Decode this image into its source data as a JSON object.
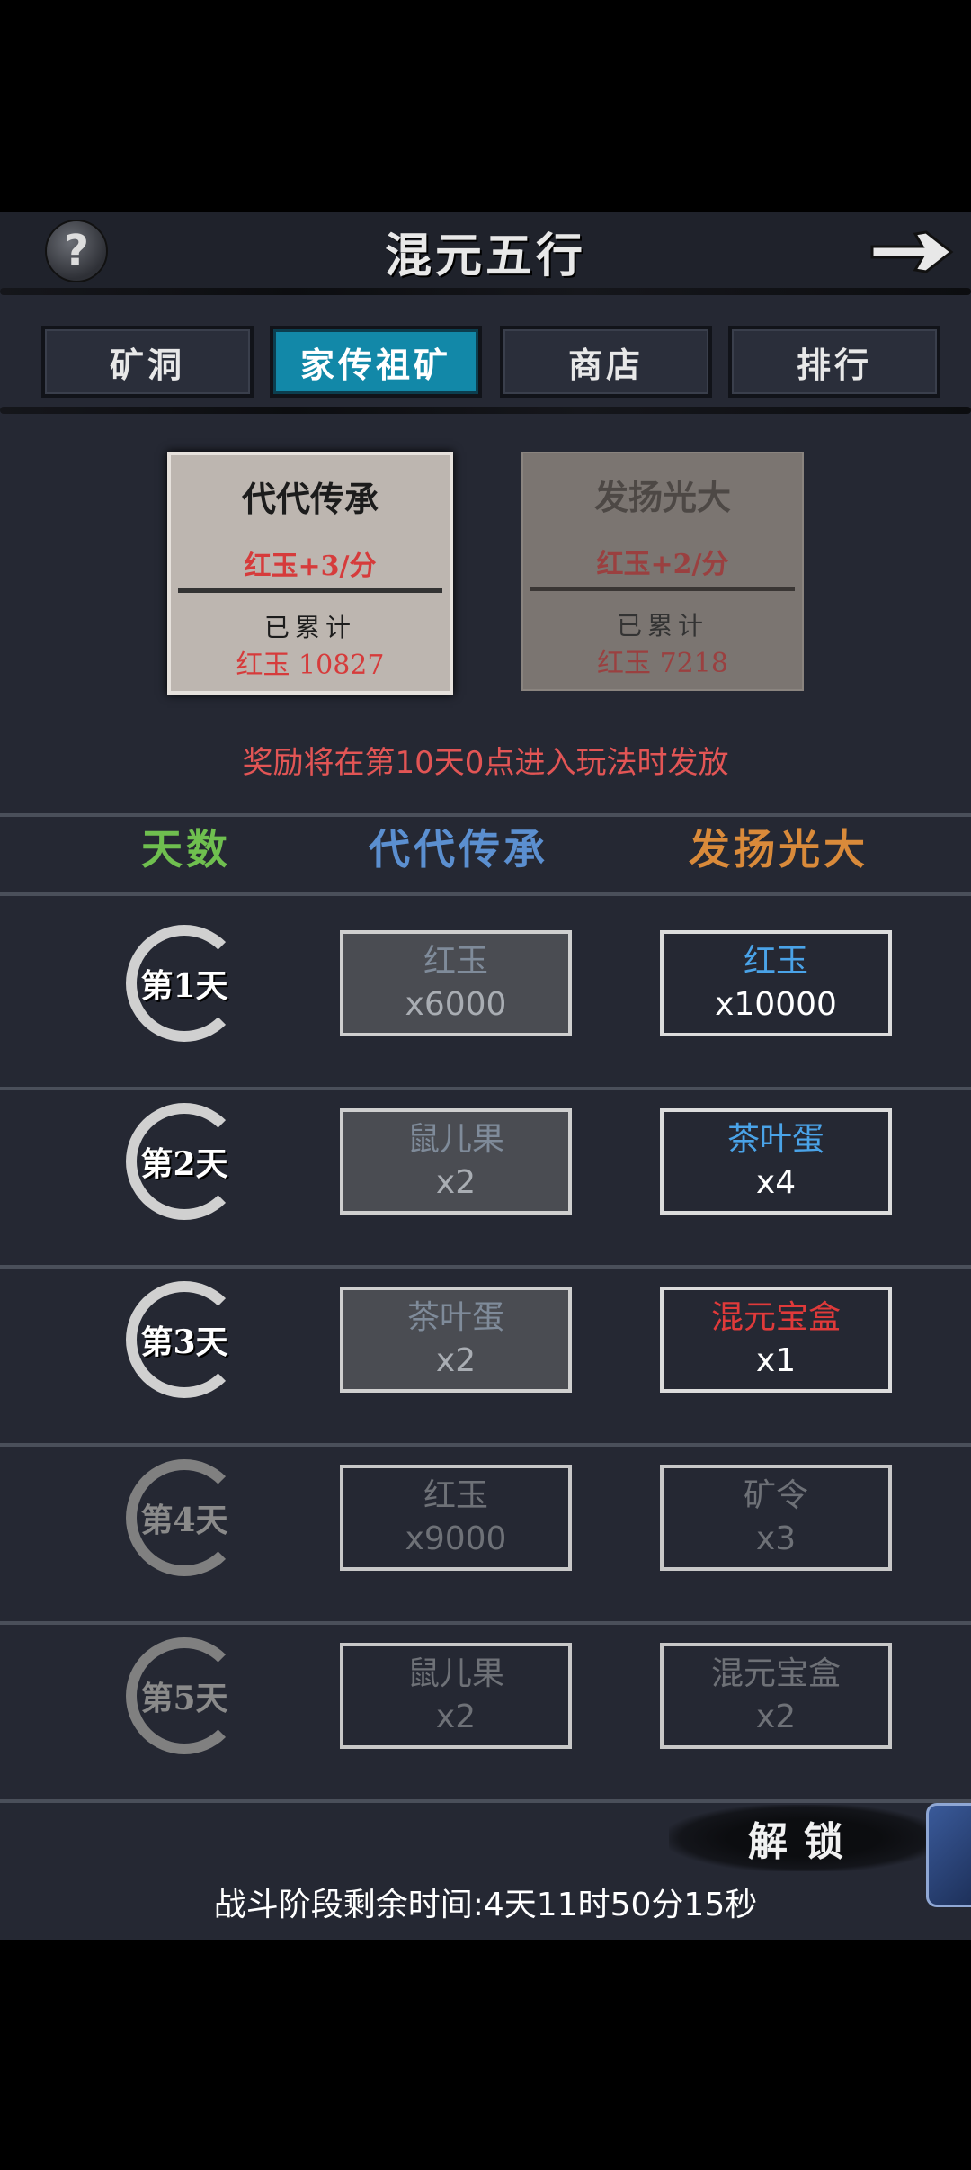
{
  "header": {
    "title": "混元五行",
    "help_label": "?"
  },
  "tabs": [
    {
      "label": "矿洞",
      "active": false
    },
    {
      "label": "家传祖矿",
      "active": true
    },
    {
      "label": "商店",
      "active": false
    },
    {
      "label": "排行",
      "active": false
    }
  ],
  "cards": [
    {
      "title": "代代传承",
      "rate": "红玉+3/分",
      "accumulated_label": "已累计",
      "total": "红玉 10827",
      "selected": true
    },
    {
      "title": "发扬光大",
      "rate": "红玉+2/分",
      "accumulated_label": "已累计",
      "total": "红玉 7218",
      "selected": false
    }
  ],
  "notice": "奖励将在第10天0点进入玩法时发放",
  "columns": {
    "day": {
      "label": "天数",
      "color": "#6fbf4f"
    },
    "line1": {
      "label": "代代传承",
      "color": "#5b8fd0"
    },
    "line2": {
      "label": "发扬光大",
      "color": "#d98a3a"
    }
  },
  "rows": [
    {
      "day": "第1天",
      "a": {
        "name": "红玉",
        "qty": "x6000",
        "state": "claimed"
      },
      "b": {
        "name": "红玉",
        "qty": "x10000",
        "state": "open",
        "color": "#4aa3e8"
      }
    },
    {
      "day": "第2天",
      "a": {
        "name": "鼠儿果",
        "qty": "x2",
        "state": "claimed"
      },
      "b": {
        "name": "茶叶蛋",
        "qty": "x4",
        "state": "open",
        "color": "#4aa3e8"
      }
    },
    {
      "day": "第3天",
      "a": {
        "name": "茶叶蛋",
        "qty": "x2",
        "state": "claimed"
      },
      "b": {
        "name": "混元宝盒",
        "qty": "x1",
        "state": "open",
        "color": "#e03a3a"
      }
    },
    {
      "day": "第4天",
      "a": {
        "name": "红玉",
        "qty": "x9000",
        "state": "locked"
      },
      "b": {
        "name": "矿令",
        "qty": "x3",
        "state": "locked"
      }
    },
    {
      "day": "第5天",
      "a": {
        "name": "鼠儿果",
        "qty": "x2",
        "state": "locked"
      },
      "b": {
        "name": "混元宝盒",
        "qty": "x2",
        "state": "locked"
      }
    }
  ],
  "unlock_label": "解锁",
  "timer": "战斗阶段剩余时间:4天11时50分15秒"
}
